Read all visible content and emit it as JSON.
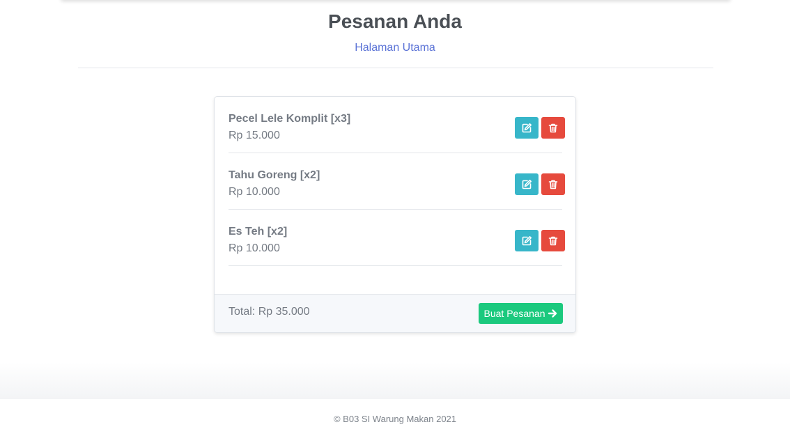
{
  "header": {
    "title": "Pesanan Anda",
    "home_link": "Halaman Utama"
  },
  "orders": [
    {
      "name": "Pecel Lele Komplit [x3]",
      "price": "Rp 15.000"
    },
    {
      "name": "Tahu Goreng [x2]",
      "price": "Rp 10.000"
    },
    {
      "name": "Es Teh [x2]",
      "price": "Rp 10.000"
    }
  ],
  "actions": {
    "edit_icon": "edit-icon",
    "delete_icon": "trash-icon"
  },
  "summary": {
    "total": "Total: Rp 35.000",
    "order_button": "Buat Pesanan",
    "order_button_icon": "arrow-right-icon"
  },
  "footer": {
    "copyright": "© B03 SI Warung Makan 2021"
  },
  "colors": {
    "edit": "#37b6c9",
    "delete": "#e64a3d",
    "primary_action": "#1bc97e",
    "link": "#5a72d6"
  }
}
